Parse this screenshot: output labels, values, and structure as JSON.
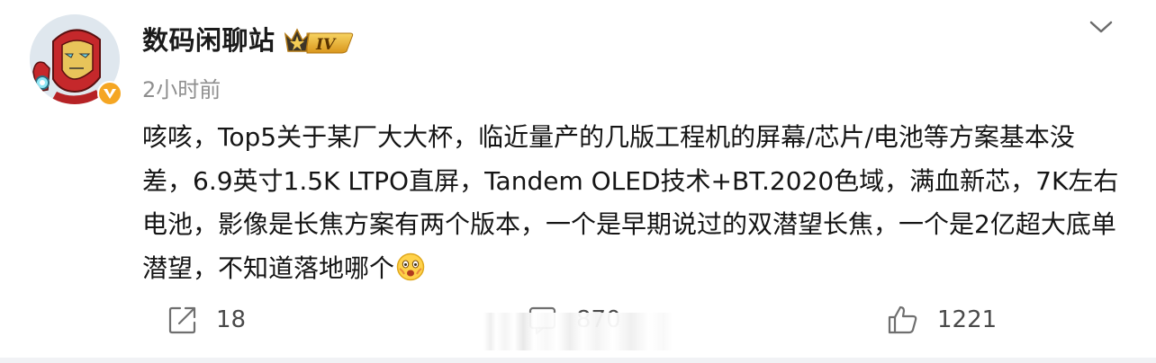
{
  "post": {
    "author": {
      "name": "数码闲聊站",
      "level": "IV",
      "avatar": "iron-man-avatar",
      "verified": "verified-badge"
    },
    "timestamp": "2小时前",
    "content_main": "咳咳，Top5关于某厂大大杯，临近量产的几版工程机的屏幕/芯片/电池等方案基本没差，6.9英寸1.5K LTPO直屏，Tandem OLED技术+BT.2020色域，满血新芯，7K左右电池，影像是长焦方案有两个版本，一个是早期说过的双潜望长焦，一个是2亿超大底单潜望，不知道落地哪个",
    "content_emoji": "surprised-face-emoji"
  },
  "actions": {
    "share": {
      "icon": "share-icon",
      "count": "18"
    },
    "comment": {
      "icon": "comment-icon",
      "count": "870"
    },
    "like": {
      "icon": "thumbs-up-icon",
      "count": "1221"
    }
  },
  "menu": {
    "icon": "chevron-down-icon"
  },
  "colors": {
    "background": "#ffffff",
    "text_primary": "#151515",
    "text_secondary": "#8f8f8f",
    "action_text": "#4a4a4a",
    "verified_badge": "#f5a623",
    "level_badge": "#e9b12e",
    "divider_strip": "#f1f2f5"
  }
}
